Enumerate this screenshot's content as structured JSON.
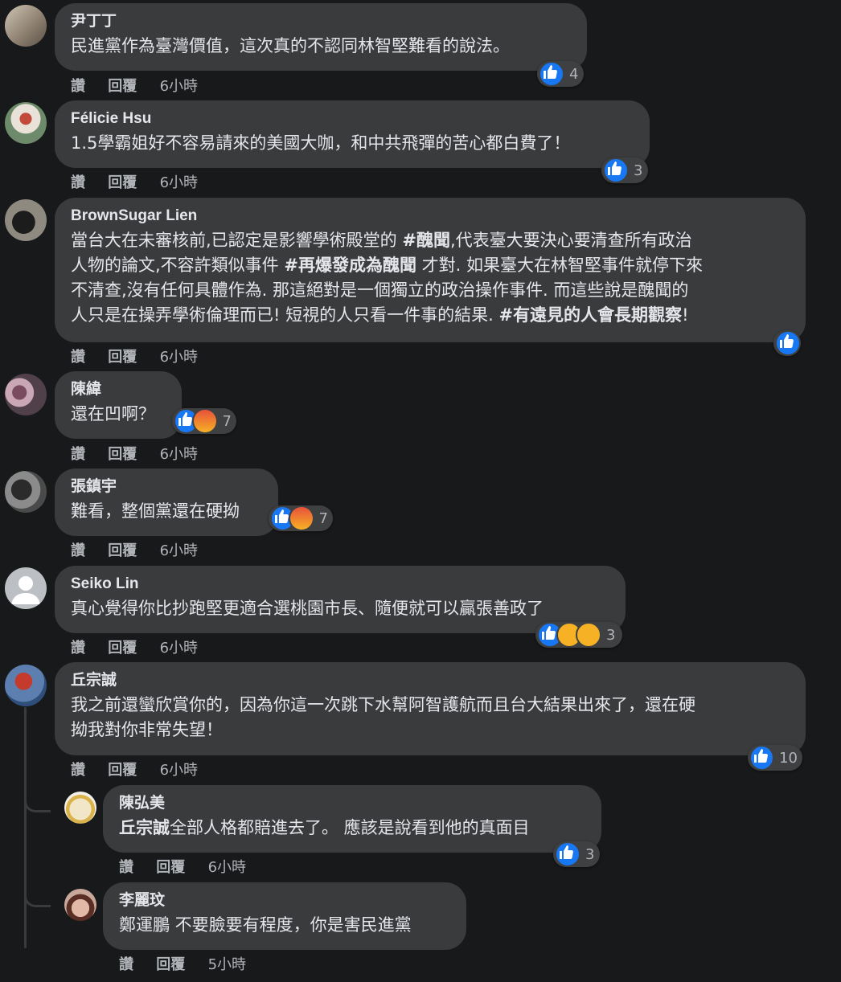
{
  "actions": {
    "like": "讚",
    "reply": "回覆"
  },
  "comments": [
    {
      "name": "尹丁丁",
      "lines": [
        "民進黨作為臺灣價值，這次真的不認同林智堅難看的說法。"
      ],
      "time": "6小時",
      "reactions": [
        "like"
      ],
      "count": "4"
    },
    {
      "name": "Félicie Hsu",
      "lines": [
        "1.5學霸姐好不容易請來的美國大咖，和中共飛彈的苦心都白費了！"
      ],
      "time": "6小時",
      "reactions": [
        "like"
      ],
      "count": "3"
    },
    {
      "name": "BrownSugar Lien",
      "line1_a": "當台大在未審核前,已認定是影響學術殿堂的 ",
      "line1_tag": "#醜聞",
      "line1_b": ",代表臺大要決心要清查所有政治",
      "line2_a": "人物的論文,不容許類似事件 ",
      "line2_tag": "#再爆發成為醜聞",
      "line2_b": " 才對. 如果臺大在林智堅事件就停下來",
      "line3": "不清查,沒有任何具體作為. 那這絕對是一個獨立的政治操作事件. 而這些說是醜聞的",
      "line4_a": "人只是在操弄學術倫理而已! 短視的人只看一件事的結果. ",
      "line4_tag": "#有遠見的人會長期觀察",
      "line4_b": "!",
      "time": "6小時",
      "reactions": [
        "like"
      ],
      "count": ""
    },
    {
      "name": "陳緯",
      "lines": [
        "還在凹啊？"
      ],
      "time": "6小時",
      "reactions": [
        "like",
        "angry"
      ],
      "count": "7"
    },
    {
      "name": "張鎮宇",
      "lines": [
        "難看，整個黨還在硬拗"
      ],
      "time": "6小時",
      "reactions": [
        "like",
        "angry"
      ],
      "count": "7"
    },
    {
      "name": "Seiko Lin",
      "lines": [
        "真心覺得你比抄跑堅更適合選桃園市長、隨便就可以贏張善政了"
      ],
      "time": "6小時",
      "reactions": [
        "like",
        "haha",
        "wow"
      ],
      "count": "3"
    },
    {
      "name": "丘宗誠",
      "lines": [
        "我之前還蠻欣賞你的，因為你這一次跳下水幫阿智護航而且台大結果出來了，還在硬",
        "拗我對你非常失望！"
      ],
      "time": "6小時",
      "reactions": [
        "like"
      ],
      "count": "10"
    }
  ],
  "replies": [
    {
      "name": "陳弘美",
      "mention": "丘宗誠",
      "text": "全部人格都賠進去了。 應該是說看到他的真面目",
      "time": "6小時",
      "reactions": [
        "like"
      ],
      "count": "3"
    },
    {
      "name": "李麗玟",
      "text": "鄭運鵬 不要臉要有程度，你是害民進黨",
      "time": "5小時"
    }
  ],
  "colors": {
    "background": "#18191a",
    "bubble": "#3a3b3c",
    "text": "#e4e6eb",
    "muted": "#b0b3b8",
    "like": "#1877f2"
  }
}
